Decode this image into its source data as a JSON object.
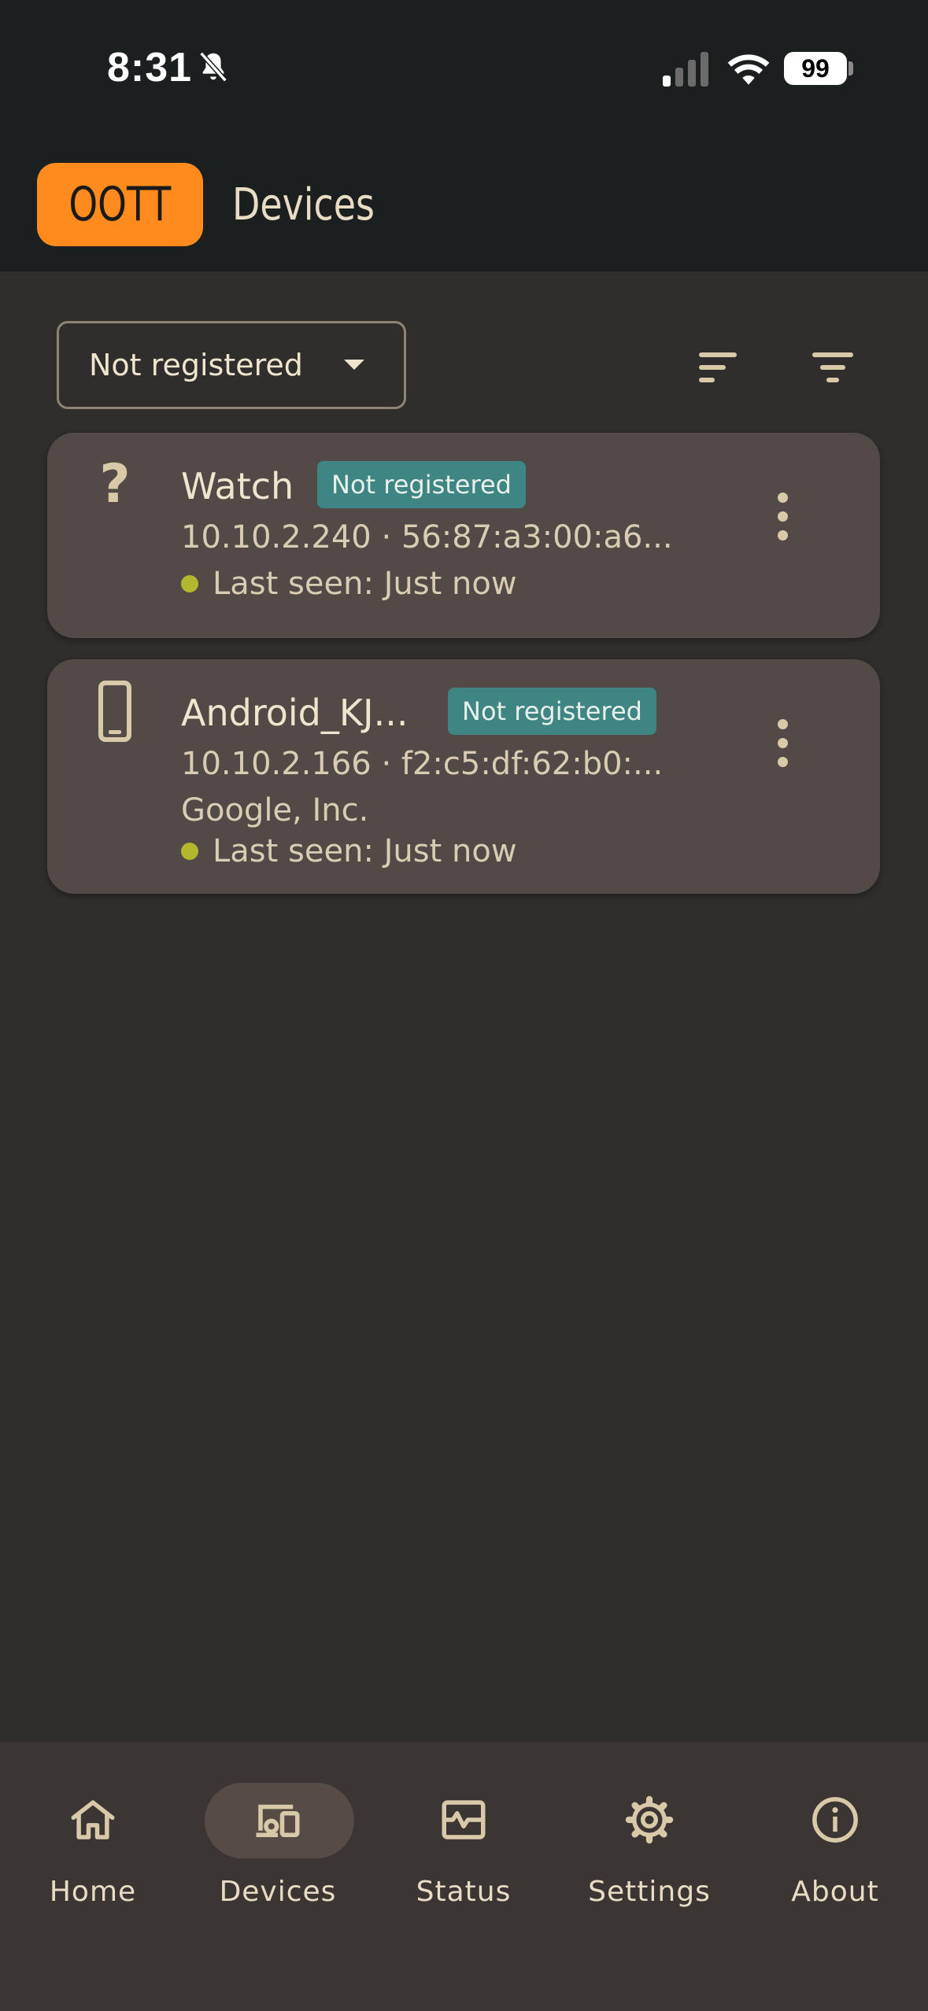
{
  "status_bar": {
    "time": "8:31",
    "battery": "99"
  },
  "app_bar": {
    "logo_text": "OOTT",
    "title": "Devices"
  },
  "filter": {
    "selected": "Not registered"
  },
  "devices": [
    {
      "name": "Watch",
      "badge": "Not registered",
      "details": "10.10.2.240 · 56:87:a3:00:a6...",
      "vendor": "",
      "last_seen": "Last seen: Just now",
      "icon": "unknown-device-icon"
    },
    {
      "name": "Android_KJ...",
      "badge": "Not registered",
      "details": "10.10.2.166 · f2:c5:df:62:b0:...",
      "vendor": "Google, Inc.",
      "last_seen": "Last seen: Just now",
      "icon": "phone-icon"
    }
  ],
  "nav": {
    "items": [
      {
        "label": "Home",
        "icon": "home-icon"
      },
      {
        "label": "Devices",
        "icon": "devices-icon"
      },
      {
        "label": "Status",
        "icon": "status-icon"
      },
      {
        "label": "Settings",
        "icon": "gear-icon"
      },
      {
        "label": "About",
        "icon": "info-icon"
      }
    ],
    "active": "Devices"
  },
  "colors": {
    "accent": "#ff8a1e",
    "badge": "#3f8583",
    "online_dot": "#b3b72e",
    "card": "#524a46",
    "background": "#302e2c"
  }
}
